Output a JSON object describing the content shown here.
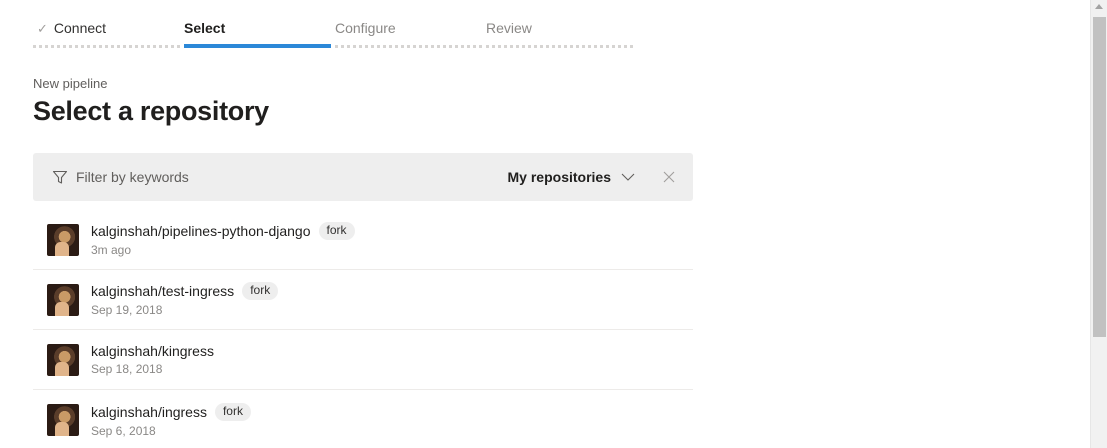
{
  "wizard": {
    "steps": [
      {
        "label": "Connect",
        "state": "done"
      },
      {
        "label": "Select",
        "state": "active"
      },
      {
        "label": "Configure",
        "state": "pending"
      },
      {
        "label": "Review",
        "state": "pending"
      }
    ],
    "check_glyph": "✓"
  },
  "header": {
    "subtitle": "New pipeline",
    "title": "Select a repository"
  },
  "filter": {
    "placeholder": "Filter by keywords",
    "value": "",
    "scope_label": "My repositories",
    "icons": {
      "filter": "filter-icon",
      "scope": "chevron-down-icon",
      "clear": "close-icon"
    }
  },
  "repositories": [
    {
      "name": "kalginshah/pipelines-python-django",
      "badge": "fork",
      "date": "3m ago"
    },
    {
      "name": "kalginshah/test-ingress",
      "badge": "fork",
      "date": "Sep 19, 2018"
    },
    {
      "name": "kalginshah/kingress",
      "badge": "",
      "date": "Sep 18, 2018"
    },
    {
      "name": "kalginshah/ingress",
      "badge": "fork",
      "date": "Sep 6, 2018"
    }
  ],
  "colors": {
    "accent": "#2b88d8",
    "filter_bg": "#eeeeee",
    "muted_text": "#8a8886"
  }
}
